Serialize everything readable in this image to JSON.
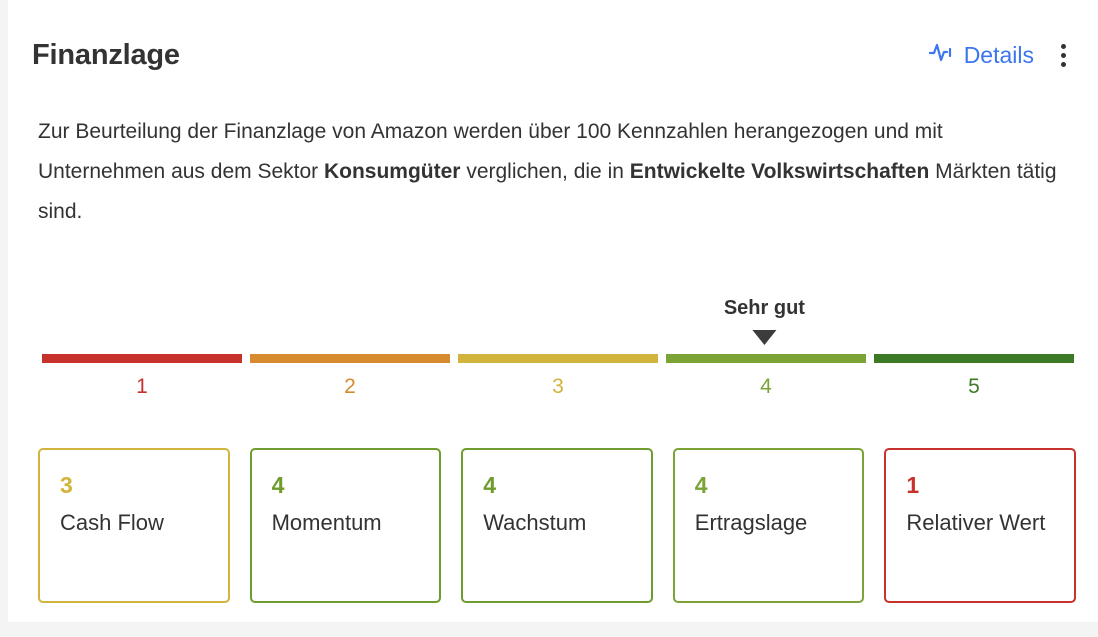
{
  "header": {
    "title": "Finanzlage",
    "details_label": "Details",
    "details_icon": "pulse-icon",
    "menu_icon": "kebab-menu-icon",
    "accent_color": "#3b76ef"
  },
  "description": {
    "part1": "Zur Beurteilung der Finanzlage von Amazon werden über 100 Kennzahlen herangezogen und mit Unternehmen aus dem Sektor ",
    "bold1": "Konsumgüter",
    "part2": " verglichen, die in ",
    "bold2": "Entwickelte Volkswirtschaften",
    "part3": " Märkten tätig sind."
  },
  "scale": {
    "pointer_label": "Sehr gut",
    "pointer_value": 4,
    "segments": [
      {
        "number": "1",
        "color": "#c8322c"
      },
      {
        "number": "2",
        "color": "#d68b30"
      },
      {
        "number": "3",
        "color": "#d1b43c"
      },
      {
        "number": "4",
        "color": "#7ba335"
      },
      {
        "number": "5",
        "color": "#3d7a25"
      }
    ]
  },
  "score_cards": [
    {
      "value": "3",
      "label": "Cash Flow",
      "color": "#d1b43c"
    },
    {
      "value": "4",
      "label": "Momentum",
      "color": "#6f9c2f"
    },
    {
      "value": "4",
      "label": "Wachstum",
      "color": "#6f9c2f"
    },
    {
      "value": "4",
      "label": "Ertragslage",
      "color": "#7ba335"
    },
    {
      "value": "1",
      "label": "Relativer Wert",
      "color": "#c8322c"
    }
  ]
}
